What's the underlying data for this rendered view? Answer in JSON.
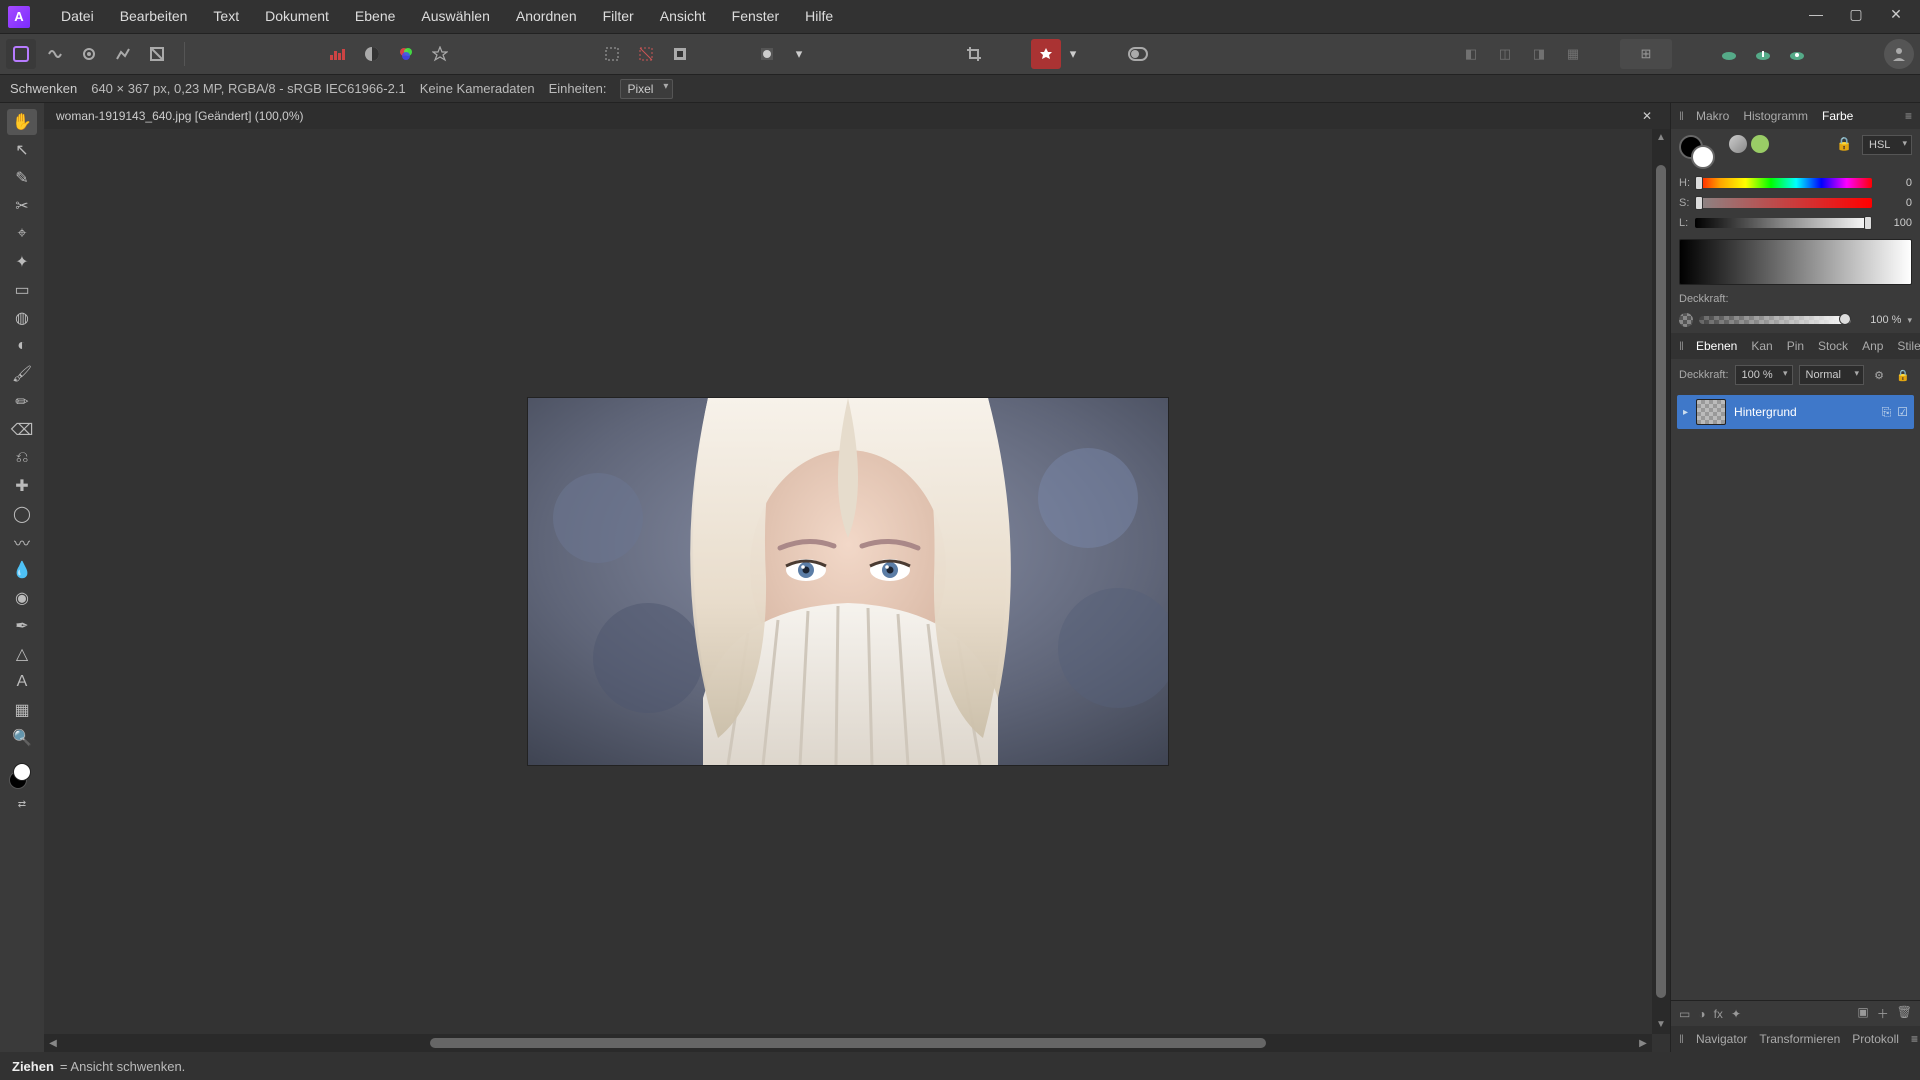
{
  "menu": [
    "Datei",
    "Bearbeiten",
    "Text",
    "Dokument",
    "Ebene",
    "Auswählen",
    "Anordnen",
    "Filter",
    "Ansicht",
    "Fenster",
    "Hilfe"
  ],
  "contextbar": {
    "tool": "Schwenken",
    "dims": "640 × 367 px, 0,23 MP, RGBA/8 - sRGB IEC61966-2.1",
    "camera": "Keine Kameradaten",
    "units_label": "Einheiten:",
    "units_value": "Pixel"
  },
  "doc_tab": {
    "title": "woman-1919143_640.jpg [Geändert] (100,0%)"
  },
  "right_tabs_top": [
    "Makro",
    "Histogramm",
    "Farbe"
  ],
  "right_tabs_top_active": 2,
  "color_panel": {
    "mode": "HSL",
    "h_label": "H:",
    "s_label": "S:",
    "l_label": "L:",
    "h": "0",
    "s": "0",
    "l": "100",
    "opacity_label": "Deckkraft:",
    "opacity": "100 %"
  },
  "right_tabs_mid": [
    "Ebenen",
    "Kan",
    "Pin",
    "Stock",
    "Anp",
    "Stile"
  ],
  "right_tabs_mid_active": 0,
  "layers": {
    "opacity_label": "Deckkraft:",
    "opacity": "100 %",
    "blend": "Normal",
    "items": [
      {
        "name": "Hintergrund"
      }
    ]
  },
  "right_tabs_bot": [
    "Navigator",
    "Transformieren",
    "Protokoll"
  ],
  "status": {
    "action": "Ziehen",
    "hint": " = Ansicht schwenken."
  }
}
